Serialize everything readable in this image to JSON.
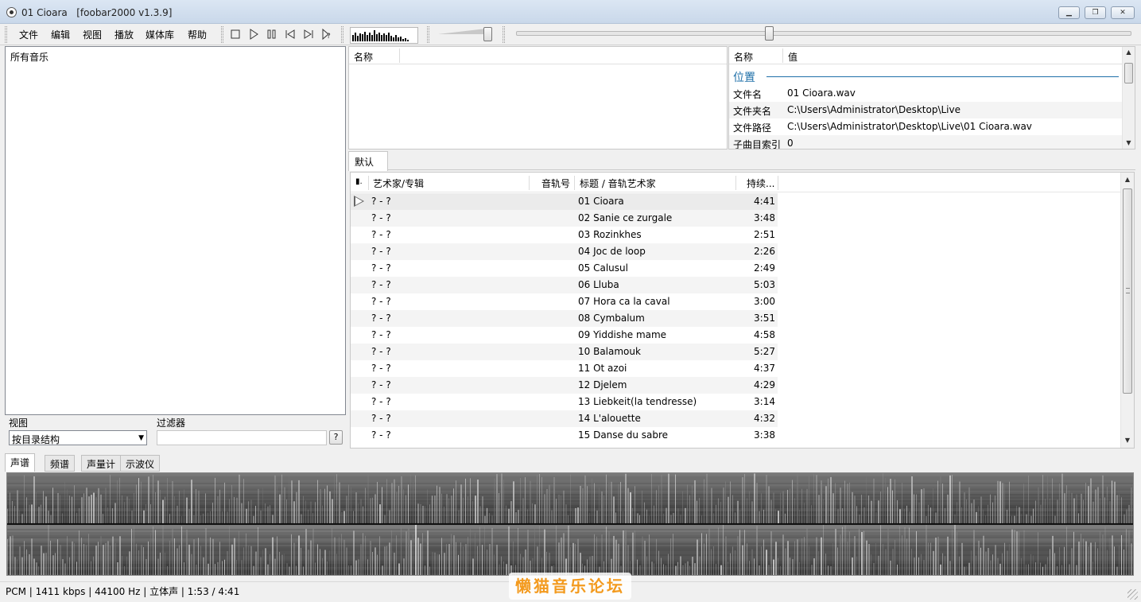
{
  "window": {
    "title": "01 Cioara   [foobar2000 v1.3.9]",
    "minimize_label": "▁",
    "maximize_label": "❐",
    "close_label": "✕"
  },
  "menu": [
    "文件",
    "编辑",
    "视图",
    "播放",
    "媒体库",
    "帮助"
  ],
  "transport_icons": [
    "stop-icon",
    "play-icon",
    "pause-icon",
    "previous-icon",
    "next-icon",
    "random-icon"
  ],
  "visualizer_levels": [
    0.55,
    0.7,
    0.45,
    0.65,
    0.6,
    0.8,
    0.5,
    0.7,
    0.55,
    0.9,
    0.6,
    0.75,
    0.5,
    0.65,
    0.55,
    0.7,
    0.45,
    0.35,
    0.5,
    0.3,
    0.4,
    0.2,
    0.25,
    0.15
  ],
  "volume_level": 0.95,
  "seek_position": 0.41,
  "library": {
    "root": "所有音乐",
    "view_label": "视图",
    "view_value": "按目录结构",
    "filter_label": "过滤器",
    "filter_value": "",
    "filter_help": "?"
  },
  "selection_panel": {
    "header": "名称"
  },
  "properties": {
    "col_name": "名称",
    "col_value": "值",
    "section": "位置",
    "rows": [
      {
        "name": "文件名",
        "value": "01 Cioara.wav"
      },
      {
        "name": "文件夹名",
        "value": "C:\\Users\\Administrator\\Desktop\\Live"
      },
      {
        "name": "文件路径",
        "value": "C:\\Users\\Administrator\\Desktop\\Live\\01 Cioara.wav"
      },
      {
        "name": "子曲目索引",
        "value": "0"
      }
    ]
  },
  "playlist": {
    "tab": "默认",
    "columns": {
      "status": "▮.",
      "artist_album": "艺术家/专辑",
      "track_no": "音轨号",
      "title": "标题 / 音轨艺术家",
      "duration": "持续..."
    },
    "rows": [
      {
        "artist": "? - ?",
        "title": "01 Cioara",
        "duration": "4:41",
        "playing": true
      },
      {
        "artist": "? - ?",
        "title": "02 Sanie ce zurgale",
        "duration": "3:48"
      },
      {
        "artist": "? - ?",
        "title": "03 Rozinkhes",
        "duration": "2:51"
      },
      {
        "artist": "? - ?",
        "title": "04 Joc de loop",
        "duration": "2:26"
      },
      {
        "artist": "? - ?",
        "title": "05 Calusul",
        "duration": "2:49"
      },
      {
        "artist": "? - ?",
        "title": "06 Lluba",
        "duration": "5:03"
      },
      {
        "artist": "? - ?",
        "title": "07 Hora ca la caval",
        "duration": "3:00"
      },
      {
        "artist": "? - ?",
        "title": "08 Cymbalum",
        "duration": "3:51"
      },
      {
        "artist": "? - ?",
        "title": "09 Yiddishe mame",
        "duration": "4:58"
      },
      {
        "artist": "? - ?",
        "title": "10 Balamouk",
        "duration": "5:27"
      },
      {
        "artist": "? - ?",
        "title": "11 Ot azoi",
        "duration": "4:37"
      },
      {
        "artist": "? - ?",
        "title": "12 Djelem",
        "duration": "4:29"
      },
      {
        "artist": "? - ?",
        "title": "13 Liebkeit(la tendresse)",
        "duration": "3:14"
      },
      {
        "artist": "? - ?",
        "title": "14 L'alouette",
        "duration": "4:32"
      },
      {
        "artist": "? - ?",
        "title": "15 Danse du sabre",
        "duration": "3:38"
      }
    ]
  },
  "vis_tabs": [
    {
      "label": "声谱",
      "active": true
    },
    {
      "label": "频谱",
      "active": false
    },
    {
      "label": "声量计",
      "active": false
    },
    {
      "label": "示波仪",
      "active": false
    }
  ],
  "status": "PCM | 1411 kbps | 44100 Hz | 立体声 | 1:53 / 4:41",
  "watermark": "懒猫音乐论坛",
  "colors": {
    "accent": "#1e6fa8",
    "watermark": "#f39a1e"
  }
}
